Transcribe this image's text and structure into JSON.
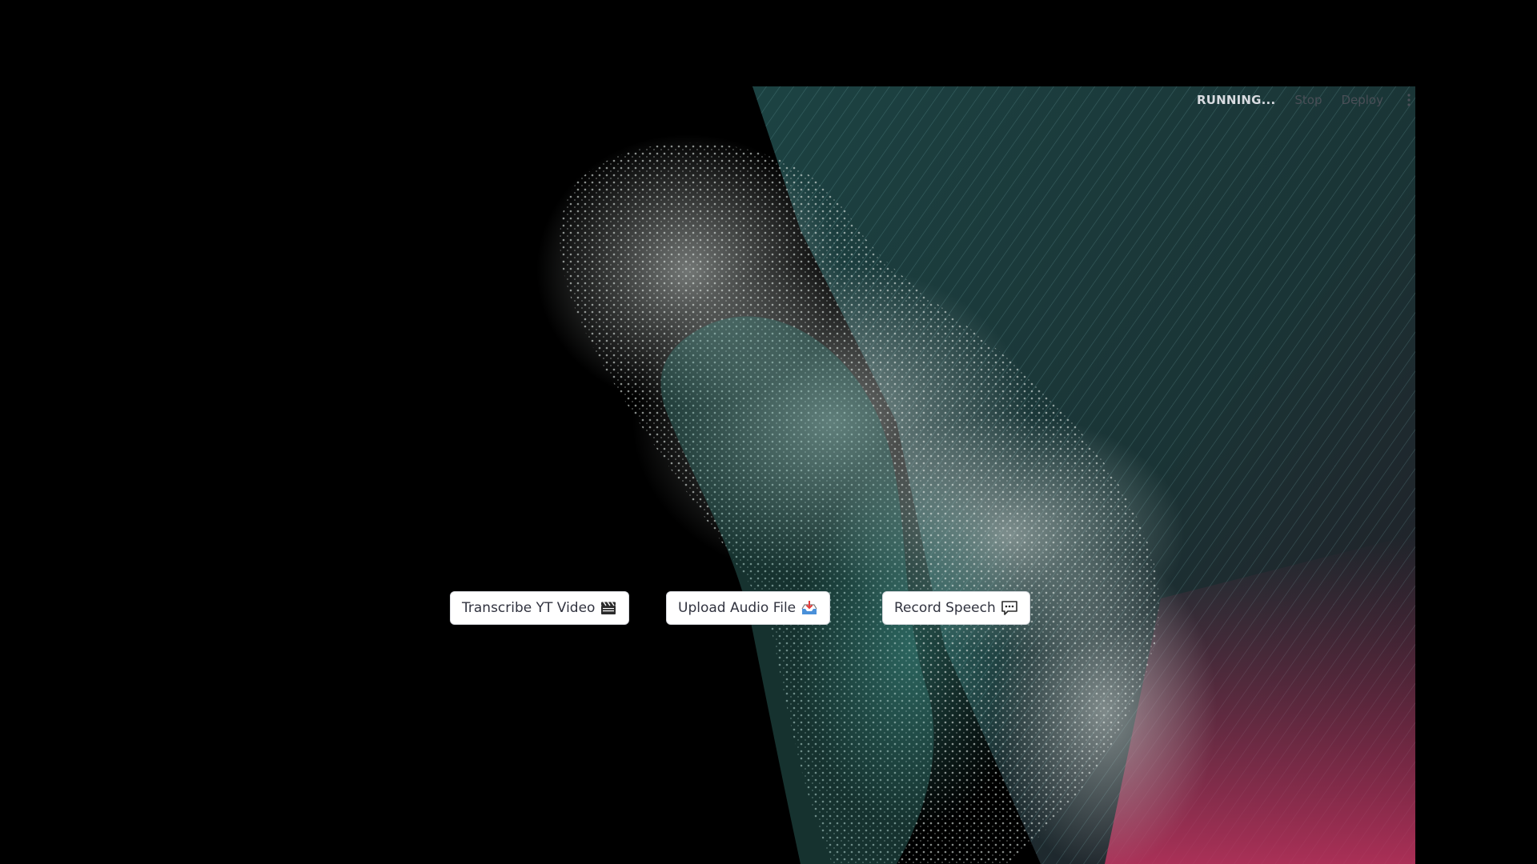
{
  "header": {
    "status": "RUNNING...",
    "stop_label": "Stop",
    "deploy_label": "Deploy",
    "menu_icon": "kebab-menu-icon"
  },
  "actions": [
    {
      "label": "Transcribe YT Video",
      "icon": "clapperboard-icon"
    },
    {
      "label": "Upload Audio File",
      "icon": "inbox-tray-icon"
    },
    {
      "label": "Record Speech",
      "icon": "speech-balloon-icon"
    }
  ],
  "colors": {
    "background": "#000000",
    "particles": "#cfd6d3",
    "teal": "#3f8f86",
    "streak_teal": "#2e5f62",
    "streak_pink": "#c2335f",
    "button_bg": "#ffffff",
    "button_text": "#31333f"
  }
}
